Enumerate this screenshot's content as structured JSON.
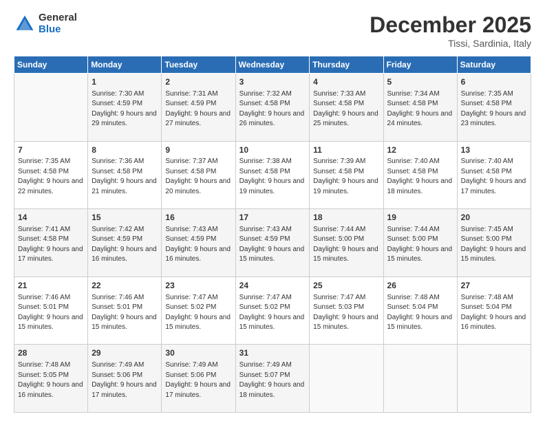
{
  "header": {
    "logo_general": "General",
    "logo_blue": "Blue",
    "month": "December 2025",
    "location": "Tissi, Sardinia, Italy"
  },
  "columns": [
    "Sunday",
    "Monday",
    "Tuesday",
    "Wednesday",
    "Thursday",
    "Friday",
    "Saturday"
  ],
  "weeks": [
    [
      {
        "day": "",
        "sunrise": "",
        "sunset": "",
        "daylight": ""
      },
      {
        "day": "1",
        "sunrise": "Sunrise: 7:30 AM",
        "sunset": "Sunset: 4:59 PM",
        "daylight": "Daylight: 9 hours and 29 minutes."
      },
      {
        "day": "2",
        "sunrise": "Sunrise: 7:31 AM",
        "sunset": "Sunset: 4:59 PM",
        "daylight": "Daylight: 9 hours and 27 minutes."
      },
      {
        "day": "3",
        "sunrise": "Sunrise: 7:32 AM",
        "sunset": "Sunset: 4:58 PM",
        "daylight": "Daylight: 9 hours and 26 minutes."
      },
      {
        "day": "4",
        "sunrise": "Sunrise: 7:33 AM",
        "sunset": "Sunset: 4:58 PM",
        "daylight": "Daylight: 9 hours and 25 minutes."
      },
      {
        "day": "5",
        "sunrise": "Sunrise: 7:34 AM",
        "sunset": "Sunset: 4:58 PM",
        "daylight": "Daylight: 9 hours and 24 minutes."
      },
      {
        "day": "6",
        "sunrise": "Sunrise: 7:35 AM",
        "sunset": "Sunset: 4:58 PM",
        "daylight": "Daylight: 9 hours and 23 minutes."
      }
    ],
    [
      {
        "day": "7",
        "sunrise": "Sunrise: 7:35 AM",
        "sunset": "Sunset: 4:58 PM",
        "daylight": "Daylight: 9 hours and 22 minutes."
      },
      {
        "day": "8",
        "sunrise": "Sunrise: 7:36 AM",
        "sunset": "Sunset: 4:58 PM",
        "daylight": "Daylight: 9 hours and 21 minutes."
      },
      {
        "day": "9",
        "sunrise": "Sunrise: 7:37 AM",
        "sunset": "Sunset: 4:58 PM",
        "daylight": "Daylight: 9 hours and 20 minutes."
      },
      {
        "day": "10",
        "sunrise": "Sunrise: 7:38 AM",
        "sunset": "Sunset: 4:58 PM",
        "daylight": "Daylight: 9 hours and 19 minutes."
      },
      {
        "day": "11",
        "sunrise": "Sunrise: 7:39 AM",
        "sunset": "Sunset: 4:58 PM",
        "daylight": "Daylight: 9 hours and 19 minutes."
      },
      {
        "day": "12",
        "sunrise": "Sunrise: 7:40 AM",
        "sunset": "Sunset: 4:58 PM",
        "daylight": "Daylight: 9 hours and 18 minutes."
      },
      {
        "day": "13",
        "sunrise": "Sunrise: 7:40 AM",
        "sunset": "Sunset: 4:58 PM",
        "daylight": "Daylight: 9 hours and 17 minutes."
      }
    ],
    [
      {
        "day": "14",
        "sunrise": "Sunrise: 7:41 AM",
        "sunset": "Sunset: 4:58 PM",
        "daylight": "Daylight: 9 hours and 17 minutes."
      },
      {
        "day": "15",
        "sunrise": "Sunrise: 7:42 AM",
        "sunset": "Sunset: 4:59 PM",
        "daylight": "Daylight: 9 hours and 16 minutes."
      },
      {
        "day": "16",
        "sunrise": "Sunrise: 7:43 AM",
        "sunset": "Sunset: 4:59 PM",
        "daylight": "Daylight: 9 hours and 16 minutes."
      },
      {
        "day": "17",
        "sunrise": "Sunrise: 7:43 AM",
        "sunset": "Sunset: 4:59 PM",
        "daylight": "Daylight: 9 hours and 15 minutes."
      },
      {
        "day": "18",
        "sunrise": "Sunrise: 7:44 AM",
        "sunset": "Sunset: 5:00 PM",
        "daylight": "Daylight: 9 hours and 15 minutes."
      },
      {
        "day": "19",
        "sunrise": "Sunrise: 7:44 AM",
        "sunset": "Sunset: 5:00 PM",
        "daylight": "Daylight: 9 hours and 15 minutes."
      },
      {
        "day": "20",
        "sunrise": "Sunrise: 7:45 AM",
        "sunset": "Sunset: 5:00 PM",
        "daylight": "Daylight: 9 hours and 15 minutes."
      }
    ],
    [
      {
        "day": "21",
        "sunrise": "Sunrise: 7:46 AM",
        "sunset": "Sunset: 5:01 PM",
        "daylight": "Daylight: 9 hours and 15 minutes."
      },
      {
        "day": "22",
        "sunrise": "Sunrise: 7:46 AM",
        "sunset": "Sunset: 5:01 PM",
        "daylight": "Daylight: 9 hours and 15 minutes."
      },
      {
        "day": "23",
        "sunrise": "Sunrise: 7:47 AM",
        "sunset": "Sunset: 5:02 PM",
        "daylight": "Daylight: 9 hours and 15 minutes."
      },
      {
        "day": "24",
        "sunrise": "Sunrise: 7:47 AM",
        "sunset": "Sunset: 5:02 PM",
        "daylight": "Daylight: 9 hours and 15 minutes."
      },
      {
        "day": "25",
        "sunrise": "Sunrise: 7:47 AM",
        "sunset": "Sunset: 5:03 PM",
        "daylight": "Daylight: 9 hours and 15 minutes."
      },
      {
        "day": "26",
        "sunrise": "Sunrise: 7:48 AM",
        "sunset": "Sunset: 5:04 PM",
        "daylight": "Daylight: 9 hours and 15 minutes."
      },
      {
        "day": "27",
        "sunrise": "Sunrise: 7:48 AM",
        "sunset": "Sunset: 5:04 PM",
        "daylight": "Daylight: 9 hours and 16 minutes."
      }
    ],
    [
      {
        "day": "28",
        "sunrise": "Sunrise: 7:48 AM",
        "sunset": "Sunset: 5:05 PM",
        "daylight": "Daylight: 9 hours and 16 minutes."
      },
      {
        "day": "29",
        "sunrise": "Sunrise: 7:49 AM",
        "sunset": "Sunset: 5:06 PM",
        "daylight": "Daylight: 9 hours and 17 minutes."
      },
      {
        "day": "30",
        "sunrise": "Sunrise: 7:49 AM",
        "sunset": "Sunset: 5:06 PM",
        "daylight": "Daylight: 9 hours and 17 minutes."
      },
      {
        "day": "31",
        "sunrise": "Sunrise: 7:49 AM",
        "sunset": "Sunset: 5:07 PM",
        "daylight": "Daylight: 9 hours and 18 minutes."
      },
      {
        "day": "",
        "sunrise": "",
        "sunset": "",
        "daylight": ""
      },
      {
        "day": "",
        "sunrise": "",
        "sunset": "",
        "daylight": ""
      },
      {
        "day": "",
        "sunrise": "",
        "sunset": "",
        "daylight": ""
      }
    ]
  ]
}
